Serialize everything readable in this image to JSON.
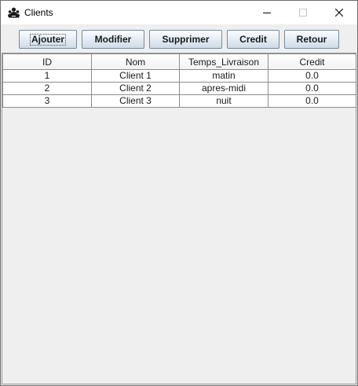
{
  "window": {
    "title": "Clients",
    "app_icon": "people-icon"
  },
  "toolbar": {
    "buttons": [
      {
        "label": "Ajouter"
      },
      {
        "label": "Modifier"
      },
      {
        "label": "Supprimer"
      },
      {
        "label": "Credit"
      },
      {
        "label": "Retour"
      }
    ]
  },
  "table": {
    "columns": [
      "ID",
      "Nom",
      "Temps_Livraison",
      "Credit"
    ],
    "rows": [
      [
        "1",
        "Client 1",
        "matin",
        "0.0"
      ],
      [
        "2",
        "Client 2",
        "apres-midi",
        "0.0"
      ],
      [
        "3",
        "Client 3",
        "nuit",
        "0.0"
      ]
    ]
  },
  "colors": {
    "button_border": "#7a8a99",
    "grid": "#8c8c8c",
    "background": "#efefef"
  }
}
